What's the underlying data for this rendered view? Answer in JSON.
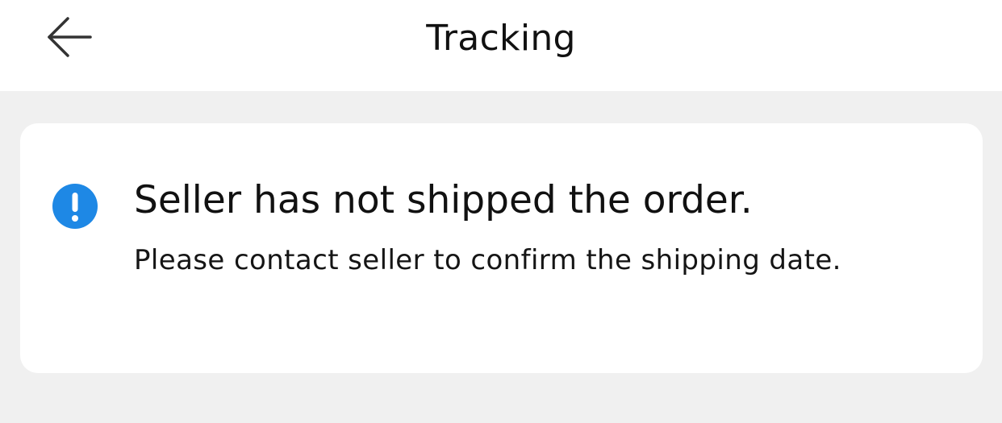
{
  "header": {
    "title": "Tracking",
    "back_icon": "arrow-left-icon"
  },
  "notice": {
    "icon": "exclamation-circle-icon",
    "icon_color": "#1e88e5",
    "title": "Seller has not shipped the order.",
    "message": "Please contact seller to confirm the shipping date."
  },
  "colors": {
    "page_background": "#f0f0f0",
    "card_background": "#ffffff",
    "text_primary": "#111111"
  }
}
